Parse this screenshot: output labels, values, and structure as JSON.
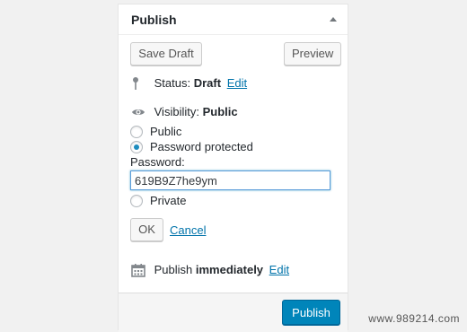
{
  "panel": {
    "title": "Publish"
  },
  "actions": {
    "save_draft": "Save Draft",
    "preview": "Preview"
  },
  "status": {
    "label": "Status:",
    "value": "Draft",
    "edit": "Edit",
    "icon": "pin-icon"
  },
  "visibility": {
    "label": "Visibility:",
    "value": "Public",
    "icon": "eye-icon",
    "options": [
      {
        "label": "Public",
        "checked": false
      },
      {
        "label": "Password protected",
        "checked": true
      },
      {
        "label": "Private",
        "checked": false
      }
    ],
    "password_label": "Password:",
    "password_value": "619B9Z7he9ym",
    "ok": "OK",
    "cancel": "Cancel"
  },
  "schedule": {
    "label": "Publish",
    "value": "immediately",
    "edit": "Edit",
    "icon": "calendar-icon"
  },
  "footer": {
    "publish": "Publish"
  },
  "colors": {
    "link": "#0073aa",
    "primary": "#0085ba",
    "radio_dot": "#1e8cbe"
  },
  "watermark": "www.989214.com"
}
